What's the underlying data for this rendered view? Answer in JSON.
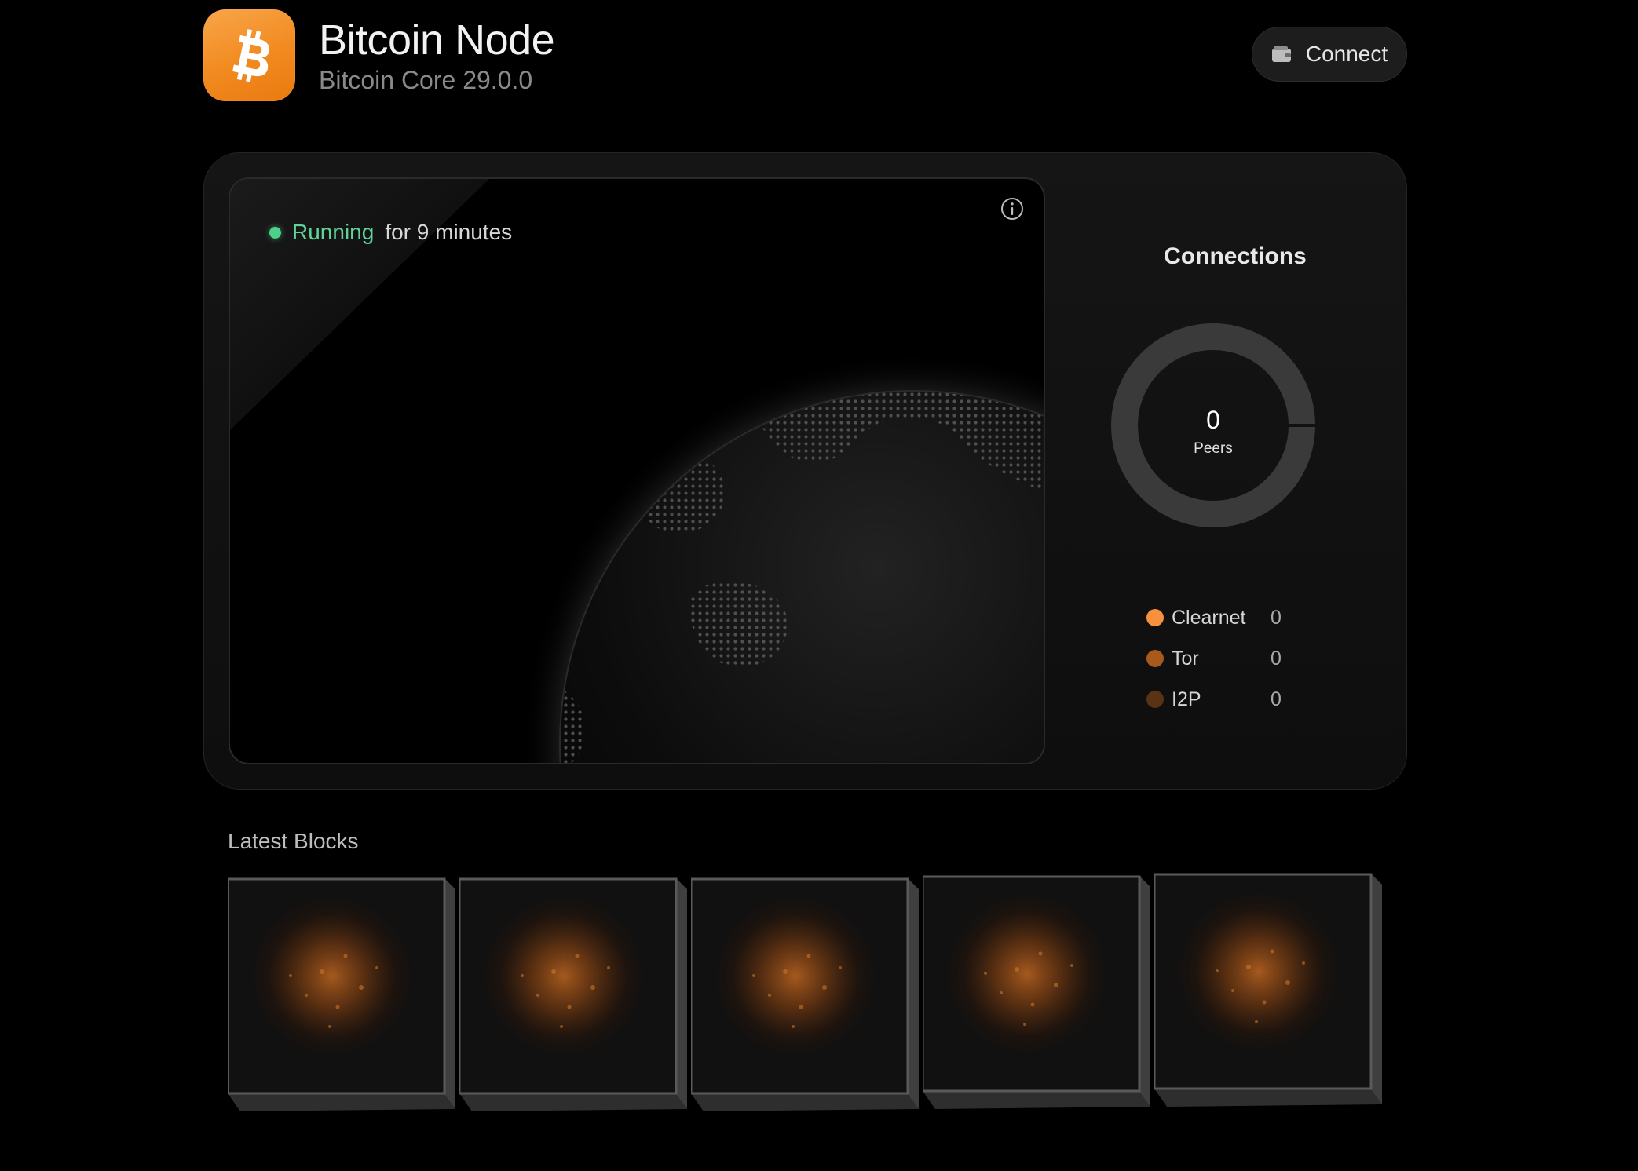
{
  "header": {
    "app_title": "Bitcoin Node",
    "app_subtitle": "Bitcoin Core 29.0.0",
    "connect_label": "Connect",
    "icon": "bitcoin-icon",
    "accent_color": "#f7931a"
  },
  "status": {
    "state_label": "Running",
    "duration_text": "for 9 minutes",
    "state_color": "#5fd39a"
  },
  "connections": {
    "title": "Connections",
    "peers_count": "0",
    "peers_label": "Peers",
    "networks": [
      {
        "name": "Clearnet",
        "count": "0",
        "color": "#f7913d"
      },
      {
        "name": "Tor",
        "count": "0",
        "color": "#a85a1c"
      },
      {
        "name": "I2P",
        "count": "0",
        "color": "#5a3314"
      }
    ]
  },
  "latest_blocks": {
    "title": "Latest Blocks",
    "count_shown": 5
  }
}
